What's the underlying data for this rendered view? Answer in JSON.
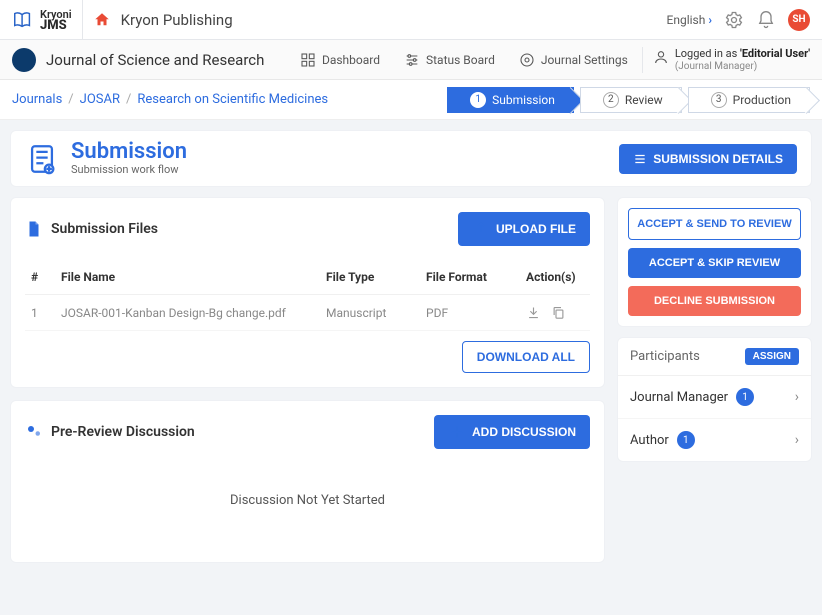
{
  "topbar": {
    "logo_line1": "Kryoni",
    "logo_line2": "JMS",
    "app_title": "Kryon Publishing",
    "language": "English",
    "avatar_initials": "SH"
  },
  "navbar": {
    "journal_name": "Journal of Science and Research",
    "items": [
      {
        "label": "Dashboard"
      },
      {
        "label": "Status Board"
      },
      {
        "label": "Journal Settings"
      }
    ],
    "logged_prefix": "Logged in as ",
    "logged_role": "'Editorial User'",
    "logged_sub": "(Journal Manager)"
  },
  "breadcrumbs": {
    "items": [
      "Journals",
      "JOSAR",
      "Research on Scientific Medicines"
    ]
  },
  "steps": [
    {
      "num": "1",
      "label": "Submission",
      "active": true
    },
    {
      "num": "2",
      "label": "Review",
      "active": false
    },
    {
      "num": "3",
      "label": "Production",
      "active": false
    }
  ],
  "page": {
    "title": "Submission",
    "subtitle": "Submission work flow",
    "details_btn": "SUBMISSION DETAILS"
  },
  "files_card": {
    "title": "Submission Files",
    "upload_btn": "UPLOAD FILE",
    "download_all_btn": "DOWNLOAD ALL",
    "columns": {
      "idx": "#",
      "name": "File Name",
      "type": "File Type",
      "format": "File Format",
      "actions": "Action(s)"
    },
    "rows": [
      {
        "idx": "1",
        "name": "JOSAR-001-Kanban Design-Bg change.pdf",
        "type": "Manuscript",
        "format": "PDF"
      }
    ]
  },
  "discussion_card": {
    "title": "Pre-Review Discussion",
    "add_btn": "ADD DISCUSSION",
    "empty_text": "Discussion Not Yet Started"
  },
  "side_actions": {
    "accept_review": "ACCEPT & SEND TO REVIEW",
    "accept_skip": "ACCEPT & SKIP REVIEW",
    "decline": "DECLINE SUBMISSION"
  },
  "participants": {
    "title": "Participants",
    "assign": "ASSIGN",
    "rows": [
      {
        "label": "Journal Manager",
        "count": "1"
      },
      {
        "label": "Author",
        "count": "1"
      }
    ]
  }
}
